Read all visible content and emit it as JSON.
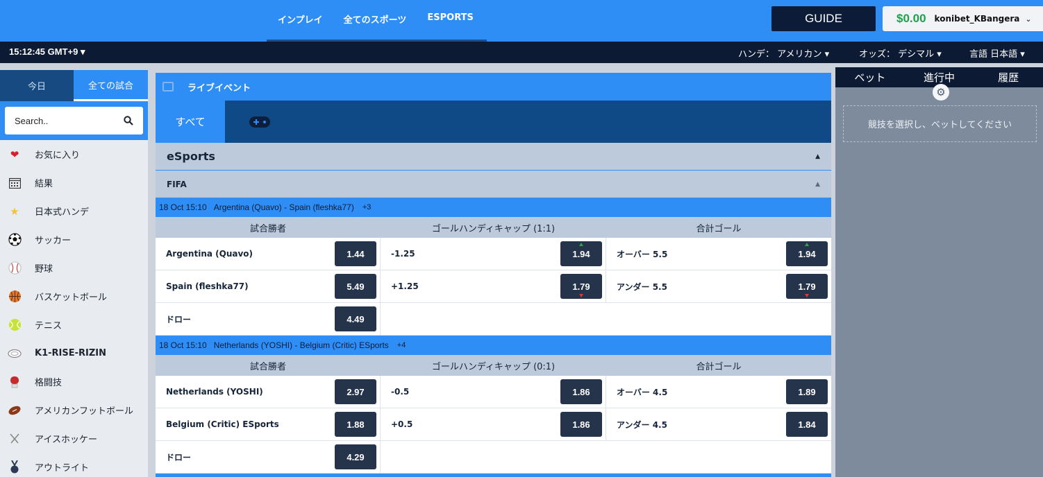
{
  "topnav": [
    "インプレイ",
    "全てのスポーツ",
    "ESPORTS"
  ],
  "guide_label": "GUIDE",
  "account": {
    "balance": "$0.00",
    "username": "konibet_KBangera"
  },
  "subbar": {
    "clock": "15:12:45 GMT+9",
    "handicap": "ハンデ： アメリカン",
    "odds": "オッズ： デシマル",
    "language": "言語 日本語"
  },
  "sidebar": {
    "tabs": [
      "今日",
      "全ての試合"
    ],
    "search_placeholder": "Search..",
    "items": [
      {
        "label": "お気に入り",
        "icon": "heart-icon"
      },
      {
        "label": "結果",
        "icon": "calendar-icon"
      },
      {
        "label": "日本式ハンデ",
        "icon": "star-badge-icon"
      },
      {
        "label": "サッカー",
        "icon": "soccer-ball-icon"
      },
      {
        "label": "野球",
        "icon": "baseball-icon"
      },
      {
        "label": "バスケットボール",
        "icon": "basketball-icon"
      },
      {
        "label": "テニス",
        "icon": "tennis-ball-icon"
      },
      {
        "label": "K1-RISE-RIZIN",
        "icon": "ring-icon"
      },
      {
        "label": "格闘技",
        "icon": "boxing-glove-icon"
      },
      {
        "label": "アメリカンフットボール",
        "icon": "football-icon"
      },
      {
        "label": "アイスホッケー",
        "icon": "hockey-sticks-icon"
      },
      {
        "label": "アウトライト",
        "icon": "medal-icon"
      }
    ]
  },
  "main": {
    "live_title": "ライブイベント",
    "tab_all": "すべて",
    "group": "eSports",
    "subgroup": "FIFA",
    "matches": [
      {
        "time": "18 Oct 15:10",
        "title": "Argentina (Quavo) - Spain (fleshka77)",
        "more": "+3",
        "col1": "試合勝者",
        "col2": "ゴールハンディキャップ (1:1)",
        "col3": "合計ゴール",
        "rows": [
          {
            "team": "Argentina (Quavo)",
            "win": "1.44",
            "hcp": "-1.25",
            "hcp_odd": "1.94",
            "tot": "オーバー 5.5",
            "tot_odd": "1.94"
          },
          {
            "team": "Spain (fleshka77)",
            "win": "5.49",
            "hcp": "+1.25",
            "hcp_odd": "1.79",
            "tot": "アンダー 5.5",
            "tot_odd": "1.79"
          },
          {
            "team": "ドロー",
            "win": "4.49"
          }
        ]
      },
      {
        "time": "18 Oct 15:10",
        "title": "Netherlands (YOSHI) - Belgium (Critic) ESports",
        "more": "+4",
        "col1": "試合勝者",
        "col2": "ゴールハンディキャップ (0:1)",
        "col3": "合計ゴール",
        "rows": [
          {
            "team": "Netherlands (YOSHI)",
            "win": "2.97",
            "hcp": "-0.5",
            "hcp_odd": "1.86",
            "tot": "オーバー 4.5",
            "tot_odd": "1.89"
          },
          {
            "team": "Belgium (Critic) ESports",
            "win": "1.88",
            "hcp": "+0.5",
            "hcp_odd": "1.86",
            "tot": "アンダー 4.5",
            "tot_odd": "1.84"
          },
          {
            "team": "ドロー",
            "win": "4.29"
          }
        ]
      }
    ]
  },
  "betslip": {
    "tabs": [
      "ベット",
      "進行中",
      "履歴"
    ],
    "empty_message": "競技を選択し、ベットしてください"
  },
  "colors": {
    "primary": "#2f8ef6",
    "dark": "#0c1a33",
    "odds_bg": "#25344b",
    "balance": "#1aa34a"
  }
}
